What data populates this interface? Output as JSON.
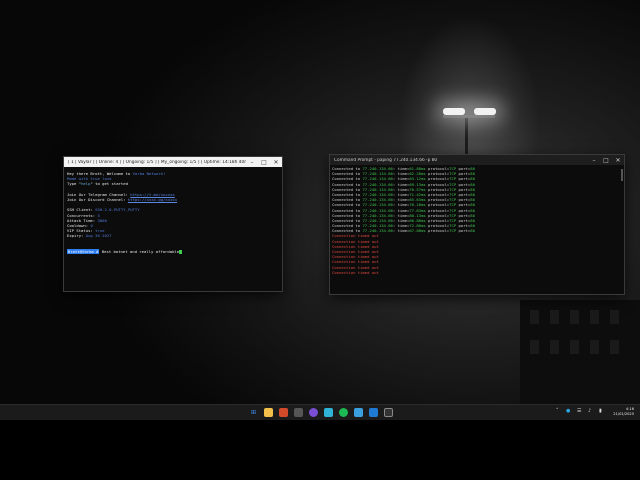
{
  "putty": {
    "title": "[ 1 | Vaylar ] [ Online: 4 ] [ Ongoing: 1/5 ] [ My_ongoing: 1/5 ] [ Uptime: 14:18h 40m 50s ] [ ]",
    "lines": {
      "welcome_prefix": "Hey there Brott, Welcome to ",
      "welcome_brand": "Varba Network!",
      "made_with": "Made with true love",
      "type_prefix": "Type \"",
      "type_cmd": "help",
      "type_suffix": "\" to get started",
      "telegram_label": "Join Our Telegram Channel: ",
      "telegram_link": "https://t.me/xxxxxx",
      "discord_label": "Join Our Discord Channel: ",
      "discord_link": "https://xxxx.gg/xxxxx",
      "ssh_label": "SSH Client: ",
      "ssh_value": "SSH-2.0-PUTTY_PUTTY",
      "conc_label": "Concurrents: ",
      "conc_value": "5",
      "attack_label": "Attack Time: ",
      "attack_value": "3000",
      "cooldown_label": "Cooldown: ",
      "cooldown_value": "0",
      "vip_label": "VIP Status: ",
      "vip_value": "true",
      "expiry_label": "Expiry: ",
      "expiry_value": "Aug 30 2027",
      "prompt_user": "Brott@Varba #",
      "prompt_text": " Best botnet and really affordable"
    }
  },
  "cmd": {
    "title": "Command Prompt - paping 77.240.134.66 -p 80",
    "connected_prefix": "Connected to ",
    "host": "77.240.134.66",
    "time_label": ": time=",
    "protocol_label": " protocol=",
    "protocol": "TCP",
    "port_label": " port=",
    "port": "80",
    "times": [
      "61.88ms",
      "62.28ms",
      "63.12ms",
      "69.13ms",
      "70.57ms",
      "71.42ms",
      "65.63ms",
      "76.18ms",
      "77.63ms",
      "80.13ms",
      "66.88ms",
      "72.80ms",
      "67.08ms"
    ],
    "timeout_text": "Connection timed out",
    "timeout_count": 8
  },
  "taskbar": {
    "clock_time": "4:16",
    "clock_date": "21/01/2025"
  },
  "colors": {
    "green": "#3fc34e",
    "red": "#e0483e",
    "blue": "#4f7bd6"
  }
}
